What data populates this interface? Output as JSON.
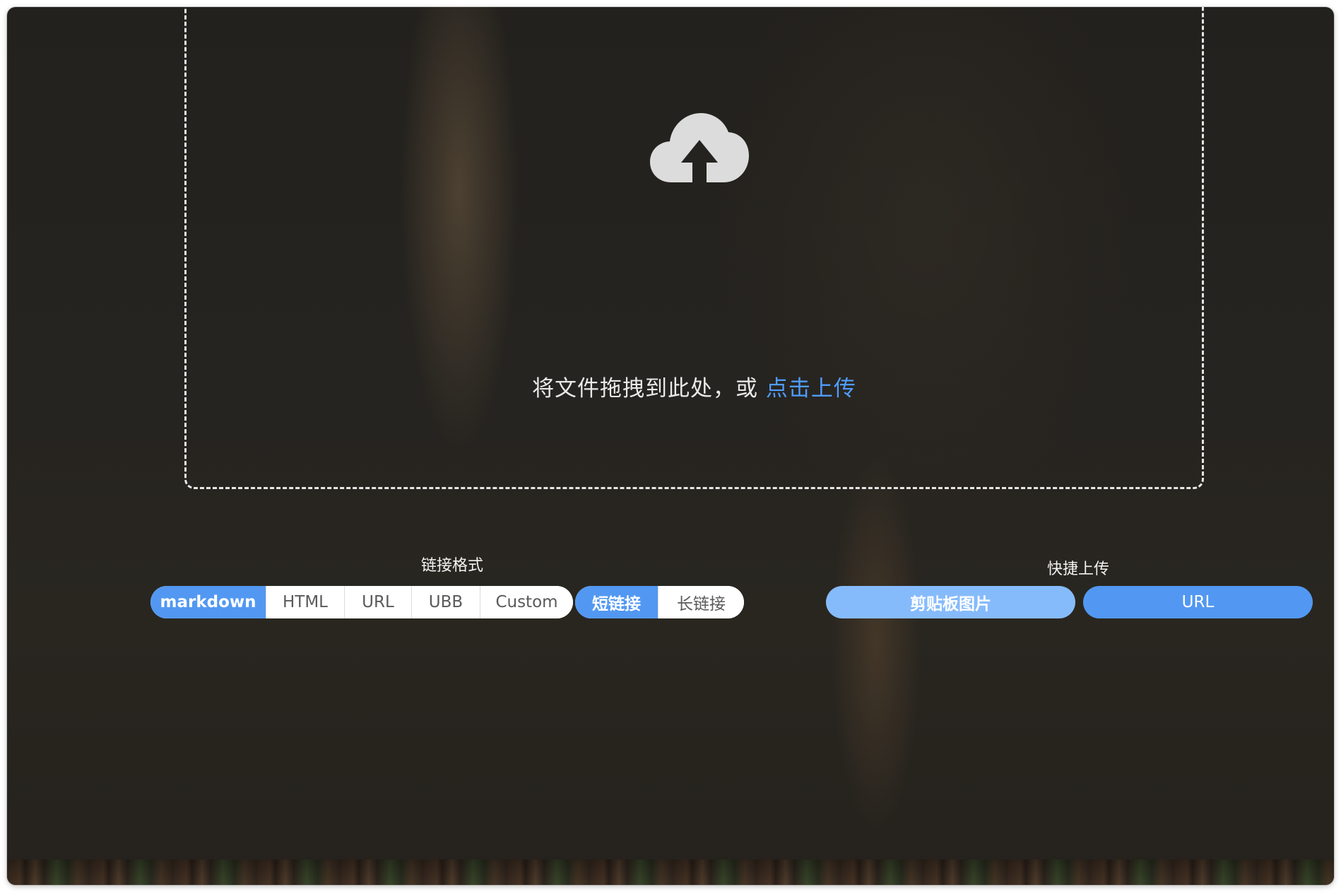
{
  "dropzone": {
    "icon": "cloud-upload-icon",
    "prompt": "将文件拖拽到此处，或",
    "link_label": "点击上传"
  },
  "link_format": {
    "label": "链接格式",
    "formats": [
      "markdown",
      "HTML",
      "URL",
      "UBB",
      "Custom"
    ],
    "selected_format": "markdown",
    "lengths": [
      "短链接",
      "长链接"
    ],
    "selected_length": "短链接"
  },
  "quick_upload": {
    "label": "快捷上传",
    "clipboard_label": "剪贴板图片",
    "url_label": "URL"
  },
  "colors": {
    "accent": "#5298f2",
    "accent_light": "#86bbfb",
    "link": "#4f9dff"
  }
}
